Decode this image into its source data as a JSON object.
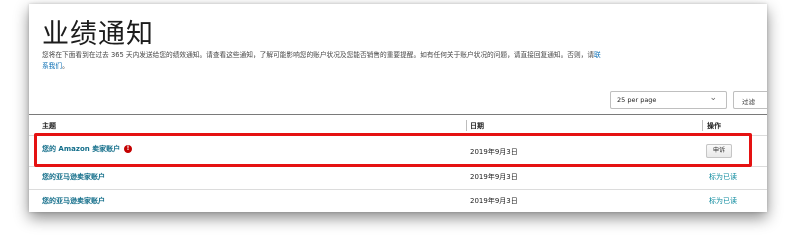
{
  "page": {
    "title": "业绩通知",
    "description": "您将在下面看到在过去 365 天内发送给您的绩效通知。请查看这些通知，了解可能影响您的账户状况及您能否销售的重要提醒。如有任何关于账户状况的问题，请直接回复通知。否则，请",
    "contact_link": "联系我们",
    "description_end": "。"
  },
  "controls": {
    "per_page_label": "25 per page",
    "filter_label": "过滤"
  },
  "table": {
    "headers": {
      "subject": "主题",
      "date": "日期",
      "actions": "操作"
    },
    "rows": [
      {
        "subject": "您的 Amazon 卖家账户",
        "alert": "!",
        "date": "2019年9月3日",
        "action": "申诉"
      },
      {
        "subject": "您的亚马逊卖家账户",
        "date": "2019年9月3日",
        "action": "标为已读"
      },
      {
        "subject": "您的亚马逊卖家账户",
        "date": "2019年9月3日",
        "action": "标为已读"
      }
    ]
  },
  "colors": {
    "highlight": "#e51212",
    "link": "#136e8a",
    "alert": "#c40000"
  }
}
